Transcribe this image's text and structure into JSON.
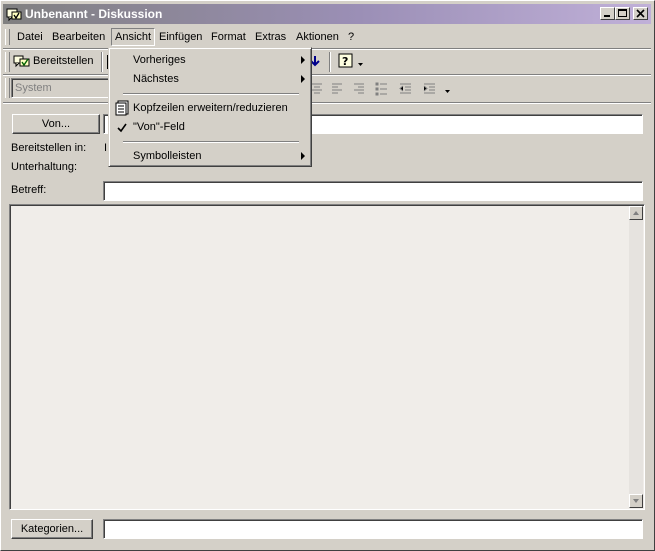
{
  "window": {
    "title": "Unbenannt - Diskussion"
  },
  "menubar": {
    "items": [
      {
        "label": "Datei"
      },
      {
        "label": "Bearbeiten"
      },
      {
        "label": "Ansicht"
      },
      {
        "label": "Einfügen"
      },
      {
        "label": "Format"
      },
      {
        "label": "Extras"
      },
      {
        "label": "Aktionen"
      },
      {
        "label": "?"
      }
    ]
  },
  "toolbar": {
    "post_label": "Bereitstellen",
    "font_combo_value": "System"
  },
  "view_menu": {
    "items": [
      {
        "label": "Vorheriges",
        "has_submenu": true
      },
      {
        "label": "Nächstes",
        "has_submenu": true
      },
      {
        "label": "Kopfzeilen erweitern/reduzieren"
      },
      {
        "label": "\"Von\"-Feld",
        "checked": true
      },
      {
        "label": "Symbolleisten",
        "has_submenu": true
      }
    ]
  },
  "form": {
    "from_button": "Von...",
    "post_in_label": "Bereitstellen in:",
    "post_in_value": "I",
    "conversation_label": "Unterhaltung:",
    "subject_label": "Betreff:",
    "categories_button": "Kategorien..."
  },
  "colors": {
    "face": "#d4d0c8",
    "titlebar_start": "#808080",
    "titlebar_end": "#c0b0d8"
  }
}
